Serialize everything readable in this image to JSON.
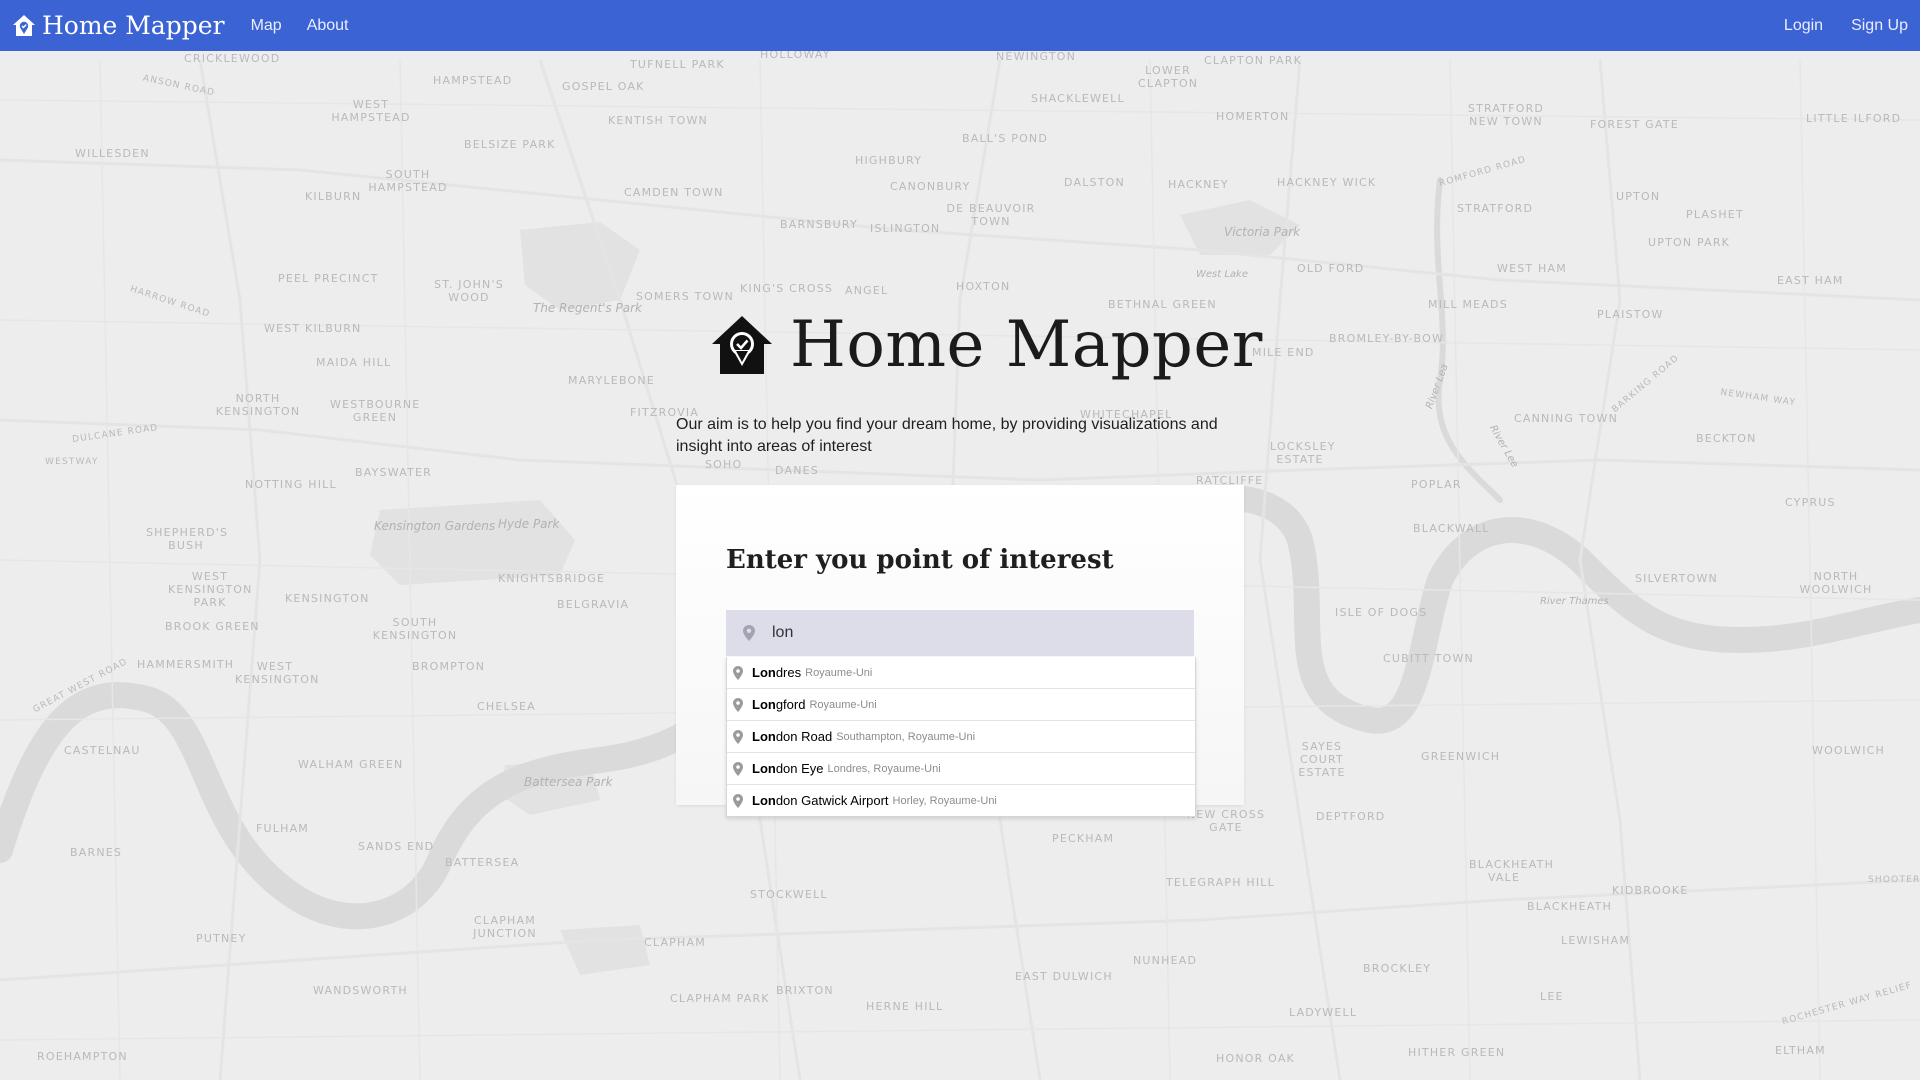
{
  "navbar": {
    "brand": "Home Mapper",
    "brand_icon": "house-pin-icon",
    "links": [
      "Map",
      "About"
    ],
    "login": "Login",
    "signup": "Sign Up",
    "color": "#3b63d3"
  },
  "hero": {
    "title": "Home Mapper",
    "icon": "house-pin-icon",
    "description": "Our aim is to help you find your dream home, by providing visualizations and insight into areas of interest"
  },
  "search_card": {
    "title": "Enter you point of interest",
    "input_value": "lon",
    "input_icon": "map-pin-icon",
    "suggestions": [
      {
        "match": "Lon",
        "rest": "dres",
        "secondary": "Royaume-Uni"
      },
      {
        "match": "Lon",
        "rest": "gford",
        "secondary": "Royaume-Uni"
      },
      {
        "match": "Lon",
        "rest": "don Road",
        "secondary": "Southampton, Royaume-Uni"
      },
      {
        "match": "Lon",
        "rest": "don Eye",
        "secondary": "Londres, Royaume-Uni"
      },
      {
        "match": "Lon",
        "rest": "don Gatwick Airport",
        "secondary": "Horley, Royaume-Uni"
      }
    ]
  },
  "map_labels": [
    "CRICKLEWOOD",
    "HAMPSTEAD",
    "GOSPEL OAK",
    "TUFNELL PARK",
    "HOLLOWAY",
    "NEWINGTON",
    "LOWER CLAPTON",
    "CLAPTON PARK",
    "STRATFORD NEW TOWN",
    "FOREST GATE",
    "LITTLE ILFORD",
    "WEST HAMPSTEAD",
    "KENTISH TOWN",
    "SHACKLEWELL",
    "HOMERTON",
    "WILLESDEN",
    "BELSIZE PARK",
    "BALL'S POND",
    "HIGHBURY",
    "SOUTH HAMPSTEAD",
    "KILBURN",
    "CAMDEN TOWN",
    "CANONBURY",
    "DALSTON",
    "HACKNEY",
    "HACKNEY WICK",
    "STRATFORD",
    "UPTON",
    "PLASHET",
    "DE BEAUVOIR TOWN",
    "BARNSBURY",
    "ISLINGTON",
    "Victoria Park",
    "UPTON PARK",
    "PEEL PRECINCT",
    "ST. JOHN'S WOOD",
    "SOMERS TOWN",
    "KING'S CROSS",
    "ANGEL",
    "HOXTON",
    "West Lake",
    "OLD FORD",
    "WEST HAM",
    "EAST HAM",
    "The Regent's Park",
    "BETHNAL GREEN",
    "MILL MEADS",
    "PLAISTOW",
    "WEST KILBURN",
    "BROMLEY-BY-BOW",
    "MAIDA HILL",
    "MILE END",
    "NORTH KENSINGTON",
    "WESTBOURNE GREEN",
    "MARYLEBONE",
    "WHITECHAPEL",
    "FITZROVIA",
    "CANNING TOWN",
    "BECKTON",
    "LOCKSLEY ESTATE",
    "SOHO",
    "DANES",
    "BAYSWATER",
    "NOTTING HILL",
    "RATCLIFFE",
    "POPLAR",
    "CYPRUS",
    "SHEPHERD'S BUSH",
    "Kensington Gardens",
    "Hyde Park",
    "BLACKWALL",
    "WEST KENSINGTON PARK",
    "KNIGHTSBRIDGE",
    "KENSINGTON",
    "BELGRAVIA",
    "SILVERTOWN",
    "NORTH WOOLWICH",
    "River Thames",
    "BROOK GREEN",
    "SOUTH KENSINGTON",
    "ISLE OF DOGS",
    "CUBITT TOWN",
    "HAMMERSMITH",
    "WEST KENSINGTON",
    "BROMPTON",
    "CHELSEA",
    "CASTELNAU",
    "WALHAM GREEN",
    "Battersea Park",
    "SAYES COURT ESTATE",
    "GREENWICH",
    "WOOLWICH",
    "FULHAM",
    "NEW CROSS GATE",
    "DEPTFORD",
    "PECKHAM",
    "BARNES",
    "SANDS END",
    "BATTERSEA",
    "BLACKHEATH VALE",
    "TELEGRAPH HILL",
    "KIDBROOKE",
    "STOCKWELL",
    "BLACKHEATH",
    "PUTNEY",
    "CLAPHAM JUNCTION",
    "CLAPHAM",
    "LEWISHAM",
    "NUNHEAD",
    "BROCKLEY",
    "EAST DULWICH",
    "WANDSWORTH",
    "CLAPHAM PARK",
    "BRIXTON",
    "HERNE HILL",
    "LEE",
    "LADYWELL",
    "ROEHAMPTON",
    "HONOR OAK",
    "HITHER GREEN",
    "ELTHAM",
    "DULCANE ROAD",
    "WESTWAY",
    "GREAT WEST ROAD",
    "ROMFORD ROAD",
    "NEWHAM WAY",
    "SHOOTERS",
    "ROCHESTER WAY RELIEF",
    "ANSON ROAD",
    "HARROW ROAD",
    "River Lea",
    "BARKING ROAD",
    "River Lee"
  ]
}
